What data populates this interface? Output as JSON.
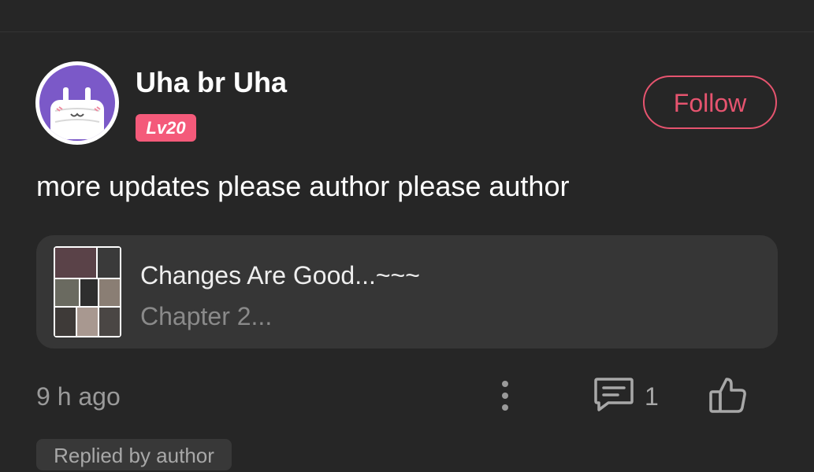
{
  "post": {
    "author": {
      "name": "Uha br Uha",
      "level": "Lv20",
      "avatar_icon": "masked-face-avatar"
    },
    "follow_label": "Follow",
    "comment": "more updates please author please author",
    "book": {
      "title": "Changes Are Good...~~~",
      "chapter": "Chapter 2..."
    },
    "time": "9 h ago",
    "reply_count": "1",
    "replied_tag": "Replied by author"
  },
  "icons": {
    "more": "vertical-dots-icon",
    "reply": "chat-bubble-icon",
    "like": "thumbs-up-icon"
  },
  "colors": {
    "background": "#262626",
    "accent": "#e6546f",
    "level_badge": "#f45a7a",
    "card": "#363636",
    "muted_text": "#9a9a9a"
  }
}
